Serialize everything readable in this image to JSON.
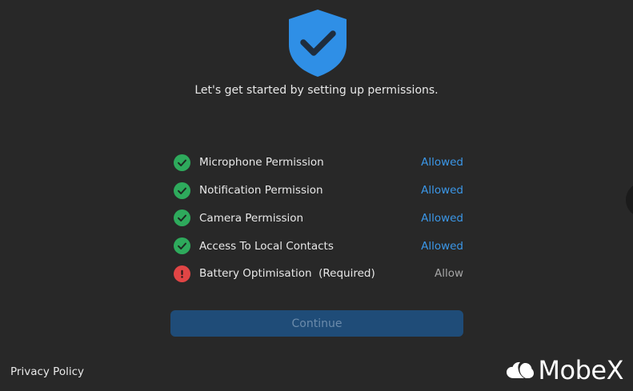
{
  "header": {
    "icon": "shield-check-icon",
    "intro_text": "Let's get started by setting up permissions."
  },
  "permissions": [
    {
      "label": "Microphone Permission",
      "status": "Allowed",
      "state": "granted",
      "icon": "check-circle-icon"
    },
    {
      "label": "Notification Permission",
      "status": "Allowed",
      "state": "granted",
      "icon": "check-circle-icon"
    },
    {
      "label": "Camera Permission",
      "status": "Allowed",
      "state": "granted",
      "icon": "check-circle-icon"
    },
    {
      "label": "Access To Local Contacts",
      "status": "Allowed",
      "state": "granted",
      "icon": "check-circle-icon"
    },
    {
      "label": "Battery Optimisation  (Required)",
      "status": "Allow",
      "state": "pending",
      "icon": "alert-circle-icon"
    }
  ],
  "actions": {
    "continue_label": "Continue"
  },
  "footer": {
    "privacy_label": "Privacy Policy",
    "brand_name": "MobeX"
  },
  "colors": {
    "background": "#282828",
    "accent_blue": "#3b97e8",
    "shield_blue": "#2f8fe6",
    "success_green": "#2eaa5c",
    "error_red": "#e14545",
    "button_disabled_bg": "#1f4c78",
    "button_disabled_text": "#6b8bab"
  }
}
